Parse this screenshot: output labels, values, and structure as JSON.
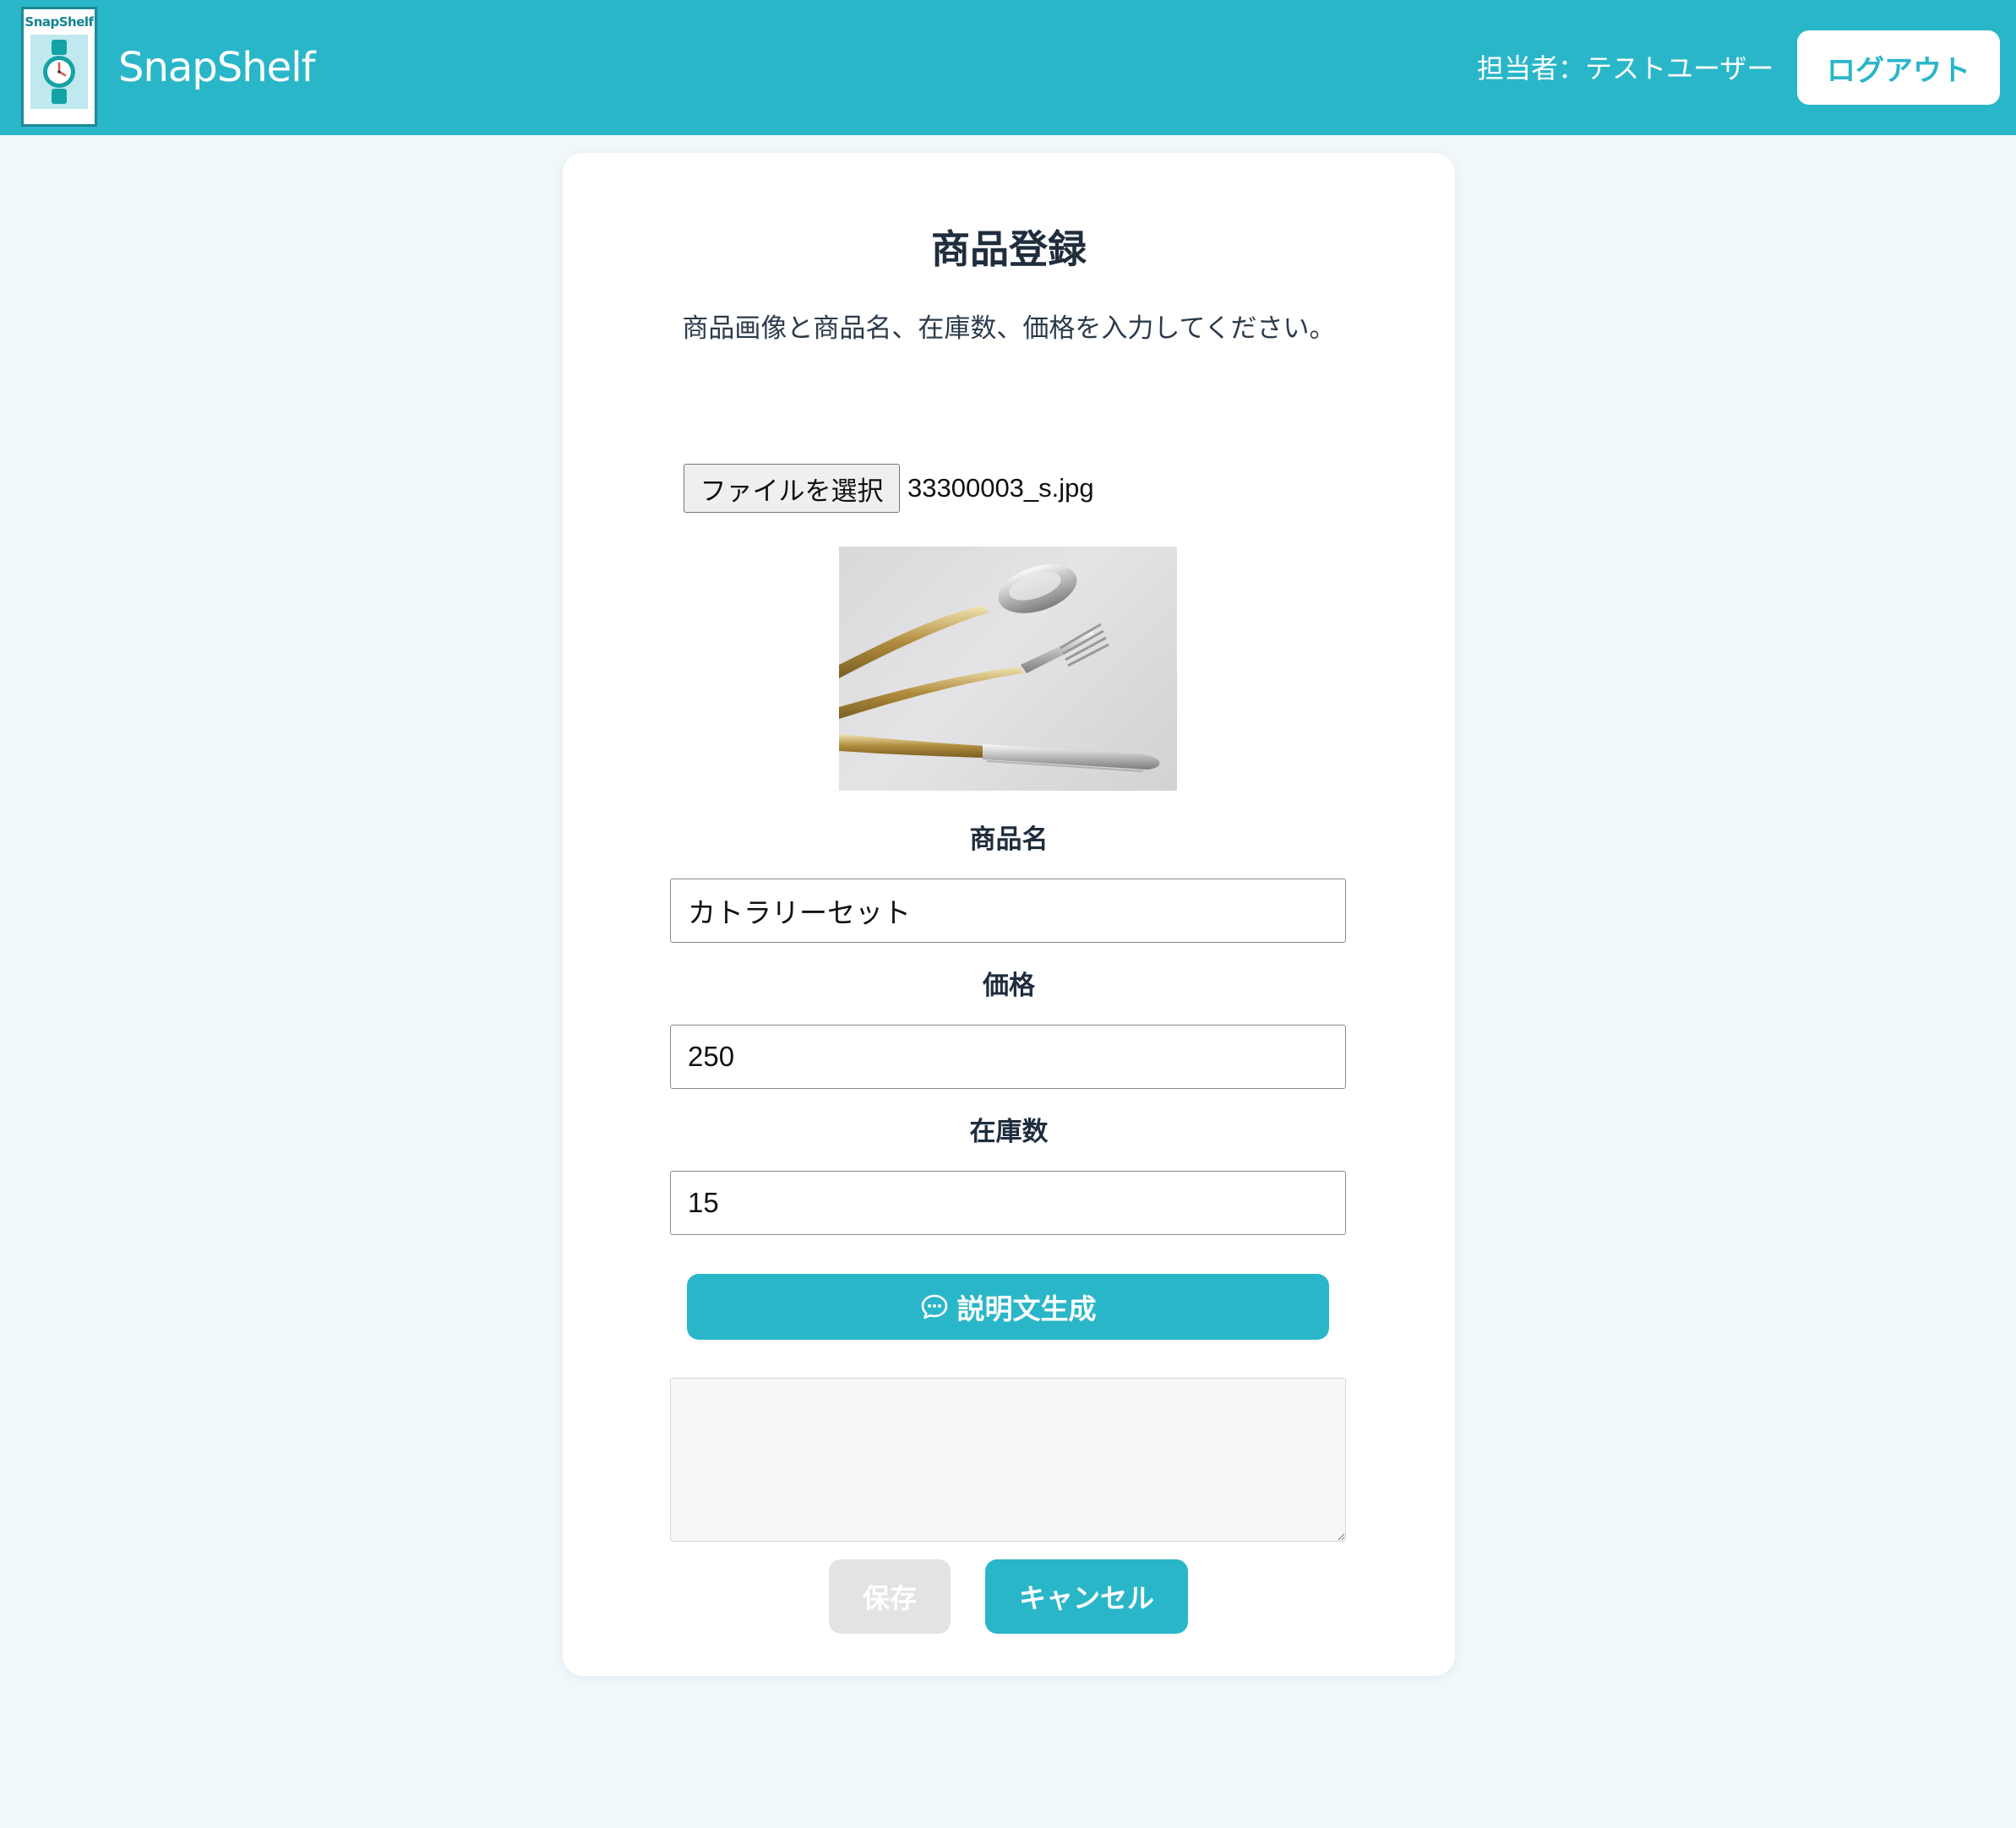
{
  "header": {
    "logo_text": "SnapShelf",
    "brand": "SnapShelf",
    "user_label": "担当者：テストユーザー",
    "logout_label": "ログアウト"
  },
  "form": {
    "title": "商品登録",
    "subtitle": "商品画像と商品名、在庫数、価格を入力してください。",
    "file_button_label": "ファイルを選択",
    "file_name": "33300003_s.jpg",
    "name_label": "商品名",
    "name_value": "カトラリーセット",
    "price_label": "価格",
    "price_value": "250",
    "stock_label": "在庫数",
    "stock_value": "15",
    "generate_label": "説明文生成",
    "description_value": "",
    "save_label": "保存",
    "cancel_label": "キャンセル"
  },
  "colors": {
    "primary": "#2ab6c9",
    "background": "#f0f8fc",
    "disabled": "#e3e3e3"
  },
  "icons": {
    "logo": "watch-icon",
    "generate": "chat-bubble-icon"
  }
}
